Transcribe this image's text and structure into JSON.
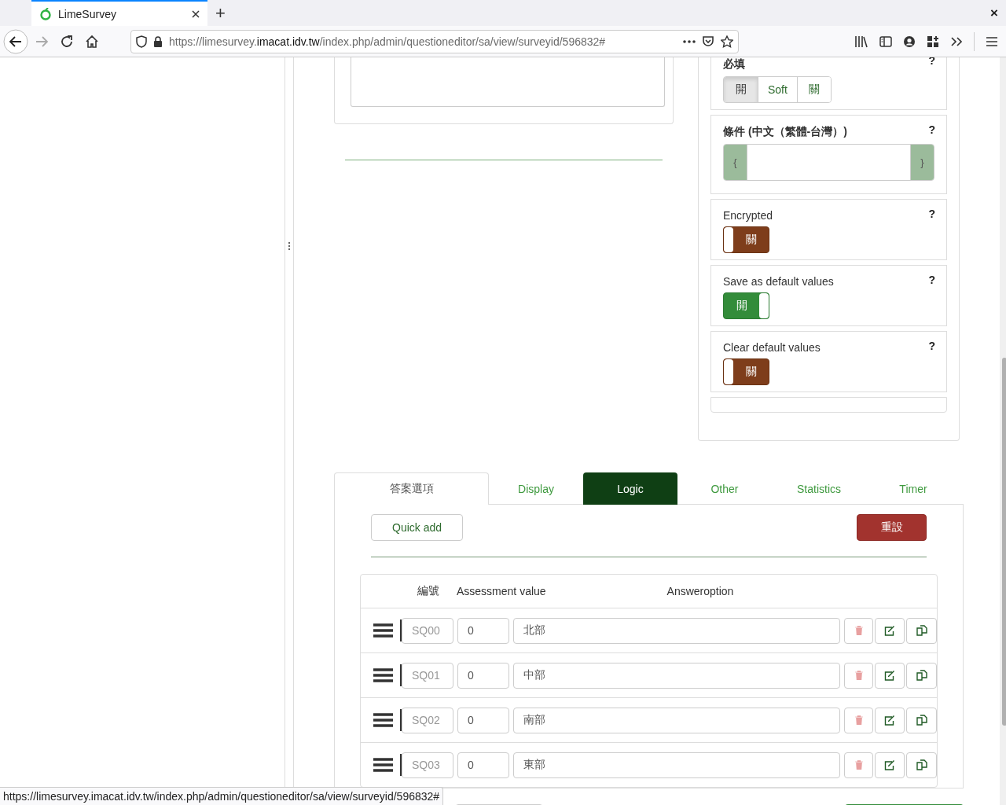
{
  "browser": {
    "tab_title": "LimeSurvey",
    "new_tab": "+",
    "close_window": "×",
    "url_prefix": "https://limesurvey.",
    "url_domain": "imacat.idv.tw",
    "url_path": "/index.php/admin/questioneditor/sa/view/surveyid/596832#"
  },
  "settings": [
    {
      "kind": "segmented",
      "label": "必填",
      "help": "?",
      "options": [
        {
          "label": "開",
          "selected": true
        },
        {
          "label": "Soft",
          "selected": false
        },
        {
          "label": "關",
          "selected": false
        }
      ]
    },
    {
      "kind": "condition",
      "label": "條件 (中文（繁體-台灣）)",
      "help": "?",
      "open_brace": "{",
      "close_brace": "}"
    },
    {
      "kind": "switch",
      "label": "Encrypted",
      "help": "?",
      "on": false,
      "state_label": "關"
    },
    {
      "kind": "switch",
      "label": "Save as default values",
      "help": "?",
      "on": true,
      "state_label": "開"
    },
    {
      "kind": "switch",
      "label": "Clear default values",
      "help": "?",
      "on": false,
      "state_label": "關"
    },
    {
      "kind": "empty"
    }
  ],
  "tabs": [
    {
      "label": "答案選項",
      "selected": true,
      "hovered": false
    },
    {
      "label": "Display",
      "selected": false,
      "hovered": false
    },
    {
      "label": "Logic",
      "selected": false,
      "hovered": true
    },
    {
      "label": "Other",
      "selected": false,
      "hovered": false
    },
    {
      "label": "Statistics",
      "selected": false,
      "hovered": false
    },
    {
      "label": "Timer",
      "selected": false,
      "hovered": false
    }
  ],
  "quick_add": "Quick add",
  "reset": "重設",
  "table": {
    "columns": [
      "編號",
      "Assessment value",
      "Answeroption"
    ],
    "rows": [
      {
        "code": "SQ00",
        "assessment": "0",
        "answer": "北部"
      },
      {
        "code": "SQ01",
        "assessment": "0",
        "answer": "中部"
      },
      {
        "code": "SQ02",
        "assessment": "0",
        "answer": "南部"
      },
      {
        "code": "SQ03",
        "assessment": "0",
        "answer": "東部"
      }
    ]
  },
  "status_bar": "https://limesurvey.imacat.idv.tw/index.php/admin/questioneditor/sa/view/surveyid/596832#"
}
